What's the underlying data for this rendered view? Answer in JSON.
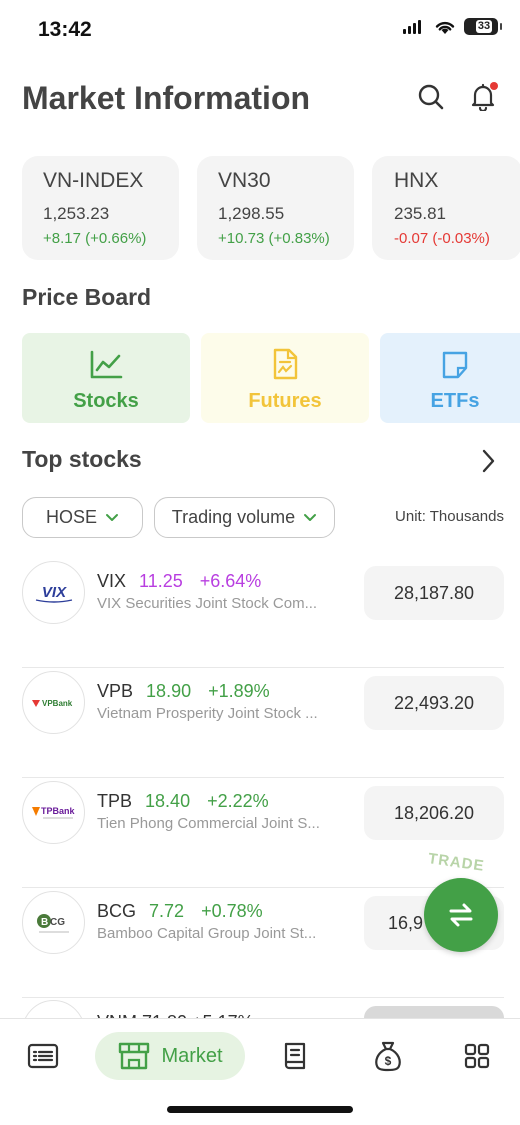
{
  "status_bar": {
    "time": "13:42",
    "battery": "33"
  },
  "header": {
    "title": "Market Information"
  },
  "indices": [
    {
      "name": "VN-INDEX",
      "value": "1,253.23",
      "change": "+8.17 (+0.66%)",
      "direction": "up"
    },
    {
      "name": "VN30",
      "value": "1,298.55",
      "change": "+10.73 (+0.83%)",
      "direction": "up"
    },
    {
      "name": "HNX",
      "value": "235.81",
      "change": "-0.07 (-0.03%)",
      "direction": "down"
    }
  ],
  "price_board": {
    "title": "Price Board",
    "items": [
      {
        "label": "Stocks",
        "icon": "line-chart-icon",
        "color": "#43a047"
      },
      {
        "label": "Futures",
        "icon": "document-icon",
        "color": "#f2c43a"
      },
      {
        "label": "ETFs",
        "icon": "note-icon",
        "color": "#46a3e3"
      }
    ]
  },
  "top_stocks": {
    "title": "Top stocks",
    "exchange_filter": "HOSE",
    "sort_filter": "Trading volume",
    "unit": "Unit: Thousands",
    "rows": [
      {
        "symbol": "VIX",
        "price": "11.25",
        "change": "+6.64%",
        "name": "VIX Securities Joint Stock Com...",
        "volume": "28,187.80",
        "logo_text": "VIX",
        "price_color": "#b83ee0"
      },
      {
        "symbol": "VPB",
        "price": "18.90",
        "change": "+1.89%",
        "name": "Vietnam Prosperity Joint Stock ...",
        "volume": "22,493.20",
        "logo_text": "VPBank",
        "price_color": "#43a047"
      },
      {
        "symbol": "TPB",
        "price": "18.40",
        "change": "+2.22%",
        "name": "Tien Phong Commercial Joint S...",
        "volume": "18,206.20",
        "logo_text": "TPBank",
        "price_color": "#43a047"
      },
      {
        "symbol": "BCG",
        "price": "7.72",
        "change": "+0.78%",
        "name": "Bamboo Capital Group Joint St...",
        "volume": "16,9",
        "logo_text": "BCG",
        "price_color": "#43a047"
      }
    ],
    "partial_row": {
      "text": "VNM 71.80 +5.17%"
    }
  },
  "trade_button": {
    "label": "TRADE"
  },
  "bottom_nav": {
    "active_label": "Market"
  },
  "colors": {
    "up": "#43a047",
    "down": "#e53935",
    "ceiling": "#b83ee0",
    "accent": "#43a047"
  }
}
